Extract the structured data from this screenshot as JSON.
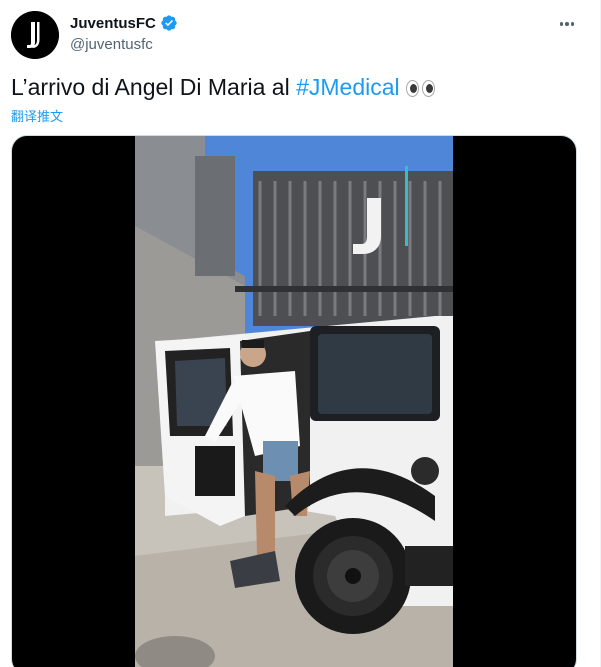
{
  "tweet": {
    "display_name": "JuventusFC",
    "handle": "@juventusfc",
    "text_main": "L’arrivo di Angel Di Maria al ",
    "hashtag": "#JMedical",
    "translate_label": "翻译推文"
  },
  "icons": {
    "avatar": "juventus-logo",
    "verified": "verified-badge-icon",
    "more": "more-options-icon",
    "emoji": "eyes-emoji"
  },
  "colors": {
    "accent": "#1d9bf0",
    "text": "#0f1419",
    "secondary": "#536471"
  }
}
